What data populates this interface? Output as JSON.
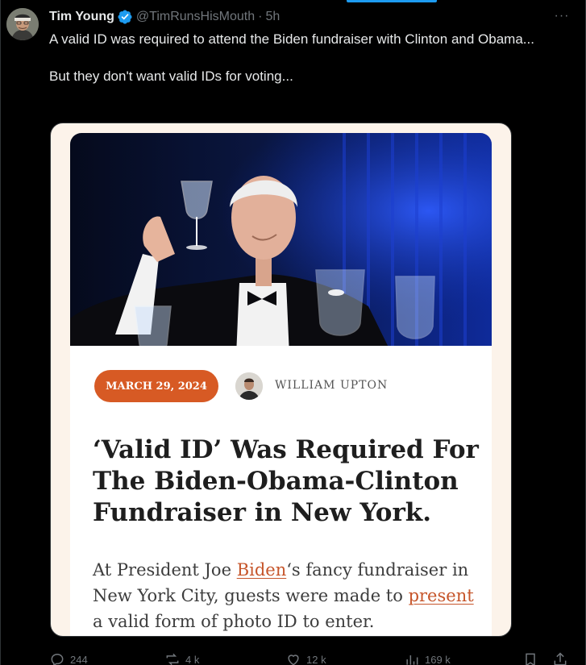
{
  "tweet": {
    "display_name": "Tim Young",
    "handle": "@TimRunsHisMouth",
    "separator": "·",
    "time": "5h",
    "more_label": "···",
    "text_line1": "A valid ID was required to attend the Biden fundraiser with Clinton and Obama...",
    "text_line2": "But they don't want valid IDs for voting..."
  },
  "article": {
    "date": "MARCH 29, 2024",
    "author": "WILLIAM UPTON",
    "headline": "‘Valid ID’ Was Required For The Biden-Obama-Clinton Fundraiser in New York.",
    "lede_part1": "At President Joe ",
    "lede_link1": "Biden",
    "lede_part2": "‘s fancy fundraiser in New York City, guests were made to ",
    "lede_link2": "present",
    "lede_part3": " a valid form of photo ID to enter."
  },
  "actions": {
    "replies": "244",
    "reposts": "4 k",
    "likes": "12 k",
    "views": "169 k"
  },
  "icons": [
    "verified-badge-icon",
    "more-icon",
    "reply-icon",
    "repost-icon",
    "like-icon",
    "views-icon",
    "bookmark-icon",
    "share-icon"
  ],
  "colors": {
    "background": "#000000",
    "accent": "#1d9bf0",
    "secondary_text": "#71767b",
    "date_pill": "#d75a24",
    "link": "#c6552a"
  }
}
